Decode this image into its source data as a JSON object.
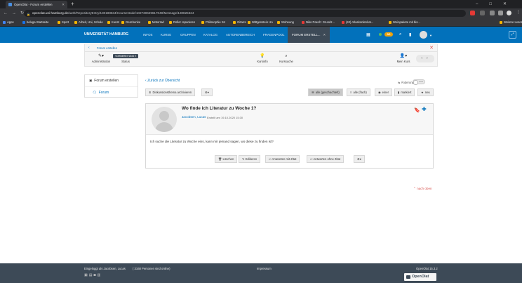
{
  "browser": {
    "tab_title": "OpenOlat - Forum erstellen",
    "url_host": "openolat.uni-hamburg.de",
    "url_path": "/auth/RepositoryEntry/130188634/CourseNode/102730629617049/Message/130825624",
    "bookmarks": [
      {
        "label": "Apps",
        "color": "#4285f4"
      },
      {
        "label": "beluga Startseite",
        "color": "#1a73e8"
      },
      {
        "label": "Sport",
        "color": "#f4b400"
      },
      {
        "label": "Arbeit, Uni, Schule",
        "color": "#f4b400"
      },
      {
        "label": "Kunst",
        "color": "#f4b400"
      },
      {
        "label": "Geschenke",
        "color": "#f4b400"
      },
      {
        "label": "Motorrad",
        "color": "#f4b400"
      },
      {
        "label": "Roller reparieren",
        "color": "#f4b400"
      },
      {
        "label": "Philosophie S4",
        "color": "#f4b400"
      },
      {
        "label": "Gitarre",
        "color": "#f4b400"
      },
      {
        "label": "Wittgenstein HA",
        "color": "#f4b400"
      },
      {
        "label": "Wohnung",
        "color": "#f4b400"
      },
      {
        "label": "Niko Paech: Grundz...",
        "color": "#e53935"
      },
      {
        "label": "(42) Atlaskonkrekar...",
        "color": "#e53935"
      },
      {
        "label": "Weinpakete mit bis...",
        "color": "#f4b400"
      },
      {
        "label": "Weitere Lesezeichen",
        "color": "#f4b400"
      }
    ]
  },
  "header": {
    "brand": "UNIVERSITÄT HAMBURG",
    "nav": [
      "INFOS",
      "KURSE",
      "GRUPPEN",
      "KATALOG",
      "AUTORENBEREICH",
      "FRAGENPOOL"
    ],
    "active_tab": "FORUM ERSTELL...",
    "badge": "0/0"
  },
  "toolbar": {
    "crumb": "Forum erstellen",
    "administration": "Administration",
    "status_btn": "VORBEREITUNG",
    "status": "Status",
    "kursinfo": "Kursinfo",
    "kurssuche": "Kurssuche",
    "mein_kurs": "Mein Kurs"
  },
  "leftmenu": {
    "root": "Forum erstellen",
    "forum": "Forum"
  },
  "main": {
    "back": "Zurück zur Übersicht",
    "changes": "Änderungen",
    "toggle": "AUS",
    "archive_btn": "Diskussionsthema archivieren",
    "view_threaded": "alle (geschachtelt)",
    "view_flat": "alle (flach)",
    "view_one": "einer",
    "view_marked": "markiert",
    "view_new": "neu"
  },
  "post": {
    "title": "Wo finde ich Literatur zu Woche 1?",
    "author": "Jacobsen, Lucas",
    "date": "Erstellt am 19.10.2020 15:30",
    "body": "Ich suche die Literatur zu Woche eins, kann mir jemand sagen, wo diese zu finden ist?",
    "delete": "Löschen",
    "edit": "Editieren",
    "reply_quote": "Antworten mit Zitat",
    "reply_noquote": "Antworten ohne Zitat"
  },
  "nach_oben": "nach oben",
  "footer": {
    "logged_in": "Eingeloggt als Jacobsen, Lucas",
    "online": "( 3168 Personen sind online)",
    "impressum": "Impressum",
    "version": "OpenOlat 15.3.2",
    "logo": "OpenOlat"
  }
}
